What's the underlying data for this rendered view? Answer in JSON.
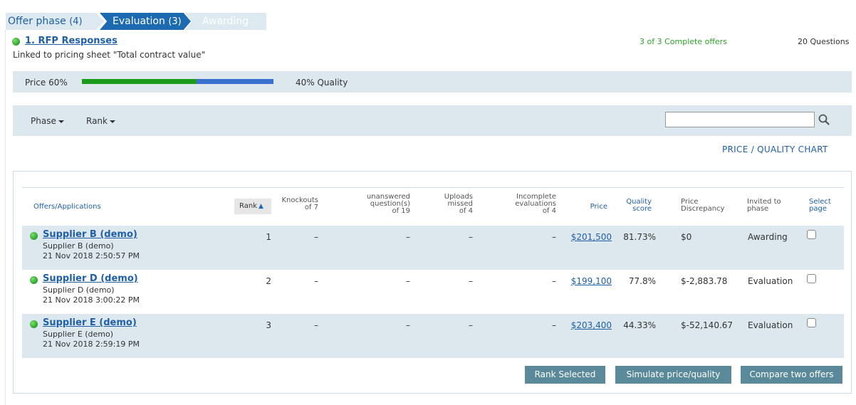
{
  "phases": {
    "offer": {
      "label": "Offer phase",
      "count": "(4)"
    },
    "evaluation": {
      "label": "Evaluation",
      "count": "(3)"
    },
    "awarding": {
      "label": "Awarding"
    }
  },
  "section": {
    "title": "1. RFP Responses",
    "linked_note": "Linked to pricing sheet \"Total contract value\"",
    "complete_offers": "3 of 3 Complete offers",
    "questions": "20 Questions"
  },
  "weighting": {
    "price_label": "Price 60%",
    "quality_label": "40% Quality",
    "price_fraction": 0.6,
    "price_color": "#1a9b1a",
    "quality_color": "#3a6fd0"
  },
  "filters": {
    "phase_label": "Phase",
    "rank_label": "Rank",
    "search_value": "",
    "search_placeholder": ""
  },
  "chart_link": "PRICE / QUALITY CHART",
  "table": {
    "headers": {
      "offers": "Offers/Applications",
      "rank": "Rank",
      "knockouts": [
        "Knockouts",
        "of 7"
      ],
      "unanswered": [
        "unanswered",
        "question(s)",
        "of 19"
      ],
      "uploads": [
        "Uploads",
        "missed",
        "of 4"
      ],
      "incomplete": [
        "Incomplete",
        "evaluations",
        "of 4"
      ],
      "price": "Price",
      "quality": [
        "Quality",
        "score"
      ],
      "discrepancy": [
        "Price",
        "Discrepancy"
      ],
      "invited": [
        "Invited to",
        "phase"
      ],
      "select": [
        "Select",
        "page"
      ]
    },
    "rows": [
      {
        "name": "Supplier B (demo)",
        "sub": "Supplier B (demo)",
        "date": "21 Nov 2018 2:50:57 PM",
        "rank": "1",
        "knockouts": "–",
        "unanswered": "–",
        "uploads": "–",
        "incomplete": "–",
        "price": "$201,500",
        "quality": "81.73%",
        "discrepancy": "$0",
        "phase": "Awarding"
      },
      {
        "name": "Supplier D (demo)",
        "sub": "Supplier D (demo)",
        "date": "21 Nov 2018 3:00:22 PM",
        "rank": "2",
        "knockouts": "–",
        "unanswered": "–",
        "uploads": "–",
        "incomplete": "–",
        "price": "$199,100",
        "quality": "77.8%",
        "discrepancy": "$-2,883.78",
        "phase": "Evaluation"
      },
      {
        "name": "Supplier E (demo)",
        "sub": "Supplier E (demo)",
        "date": "21 Nov 2018 2:59:19 PM",
        "rank": "3",
        "knockouts": "–",
        "unanswered": "–",
        "uploads": "–",
        "incomplete": "–",
        "price": "$203,400",
        "quality": "44.33%",
        "discrepancy": "$-52,140.67",
        "phase": "Evaluation"
      }
    ]
  },
  "buttons": {
    "rank_selected": "Rank Selected",
    "simulate": "Simulate price/quality",
    "compare": "Compare two offers"
  }
}
